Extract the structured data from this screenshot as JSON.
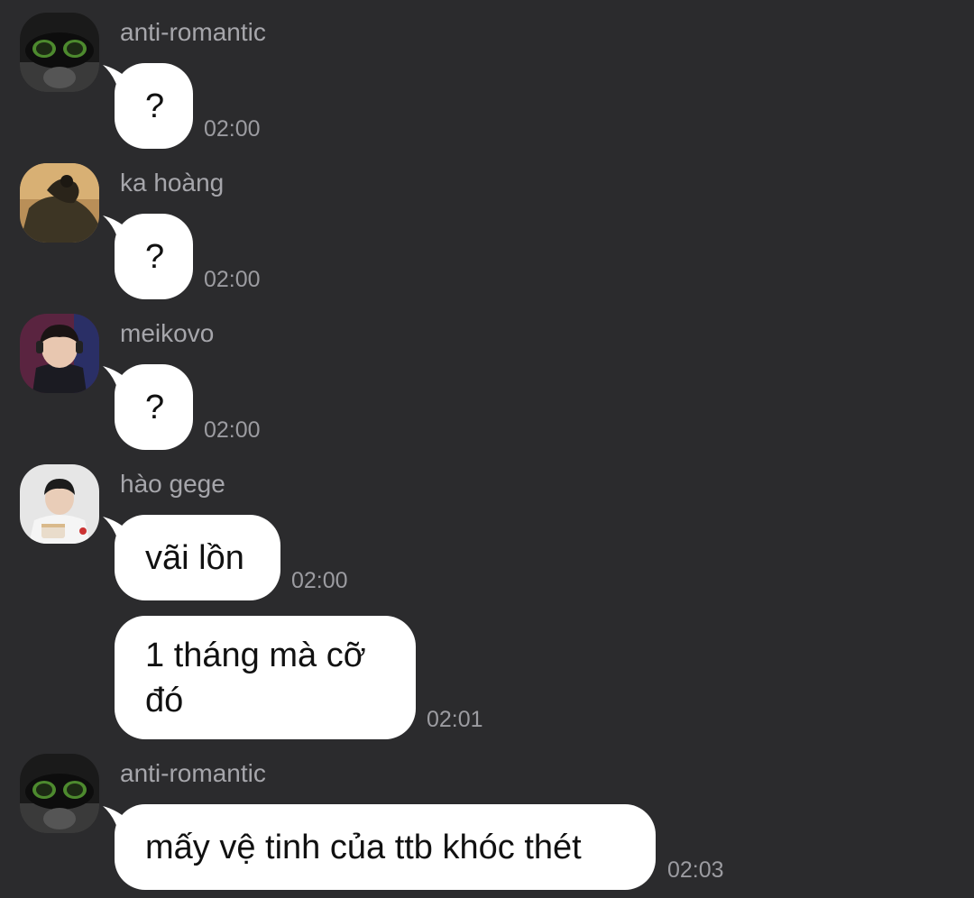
{
  "messages": [
    {
      "sender": "anti-romantic",
      "avatar": "avatar-anti-romantic",
      "text": "?",
      "time": "02:00"
    },
    {
      "sender": "ka hoàng",
      "avatar": "avatar-ka-hoang",
      "text": "?",
      "time": "02:00"
    },
    {
      "sender": "meikovo",
      "avatar": "avatar-meikovo",
      "text": "?",
      "time": "02:00"
    },
    {
      "sender": "hào gege",
      "avatar": "avatar-hao-gege",
      "text": "vãi lồn",
      "time": "02:00"
    },
    {
      "sender": "",
      "avatar": "",
      "text_line1": "1 tháng mà cỡ",
      "text_line2": "đó",
      "time": "02:01"
    },
    {
      "sender": "anti-romantic",
      "avatar": "avatar-anti-romantic",
      "text": "mấy vệ tinh của ttb khóc thét",
      "time": "02:03"
    }
  ],
  "colors": {
    "background": "#2b2b2d",
    "bubble": "#ffffff",
    "sender_name": "#a6a6ab",
    "timestamp": "#9c9ca1"
  }
}
